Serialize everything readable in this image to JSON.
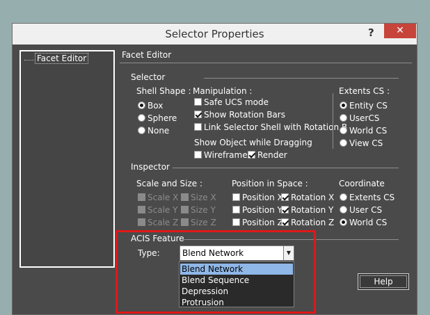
{
  "window": {
    "title": "Selector Properties",
    "help_glyph": "?",
    "close_glyph": "✕"
  },
  "tree": {
    "item": "Facet Editor"
  },
  "content": {
    "header": "Facet Editor",
    "selector": {
      "title": "Selector",
      "shell_shape": {
        "title": "Shell Shape :",
        "options": [
          {
            "label": "Box",
            "checked": true
          },
          {
            "label": "Sphere",
            "checked": false
          },
          {
            "label": "None",
            "checked": false
          }
        ]
      },
      "manipulation": {
        "title": "Manipulation :",
        "options": [
          {
            "label": "Safe UCS mode",
            "checked": false
          },
          {
            "label": "Show Rotation Bars",
            "checked": true
          },
          {
            "label": "Link Selector Shell with Rotation B",
            "checked": false
          }
        ]
      },
      "show_object": {
        "title": "Show Object while Dragging",
        "wireframe": {
          "label": "Wireframe",
          "checked": false
        },
        "render": {
          "label": "Render",
          "checked": true
        }
      },
      "extents_cs": {
        "title": "Extents CS :",
        "options": [
          {
            "label": "Entity CS",
            "checked": true
          },
          {
            "label": "UserCS",
            "checked": false
          },
          {
            "label": "World CS",
            "checked": false
          },
          {
            "label": "View CS",
            "checked": false
          }
        ]
      }
    },
    "inspector": {
      "title": "Inspector",
      "scale_size": {
        "title": "Scale and Size :",
        "rows": [
          {
            "scale": "Scale X",
            "size": "Size X"
          },
          {
            "scale": "Scale Y",
            "size": "Size Y"
          },
          {
            "scale": "Scale Z",
            "size": "Size Z"
          }
        ]
      },
      "position": {
        "title": "Position in Space :",
        "rows": [
          {
            "position": "Position X",
            "rotation": "Rotation X",
            "pos_checked": false,
            "rot_checked": true
          },
          {
            "position": "Position Y",
            "rotation": "Rotation Y",
            "pos_checked": false,
            "rot_checked": true
          },
          {
            "position": "Position Z",
            "rotation": "Rotation Z",
            "pos_checked": false,
            "rot_checked": true
          }
        ]
      },
      "coordinate": {
        "title": "Coordinate",
        "options": [
          {
            "label": "Extents CS",
            "checked": false
          },
          {
            "label": "User CS",
            "checked": false
          },
          {
            "label": "World CS",
            "checked": true
          }
        ]
      }
    },
    "acis": {
      "title": "ACIS Feature",
      "type_label": "Type:",
      "selected": "Blend Network",
      "options": [
        "Blend Network",
        "Blend Sequence",
        "Depression",
        "Protrusion"
      ]
    }
  },
  "buttons": {
    "help": "Help"
  },
  "colors": {
    "accent": "#8fb7e8",
    "highlight": "#e01818",
    "close": "#c7443a"
  }
}
